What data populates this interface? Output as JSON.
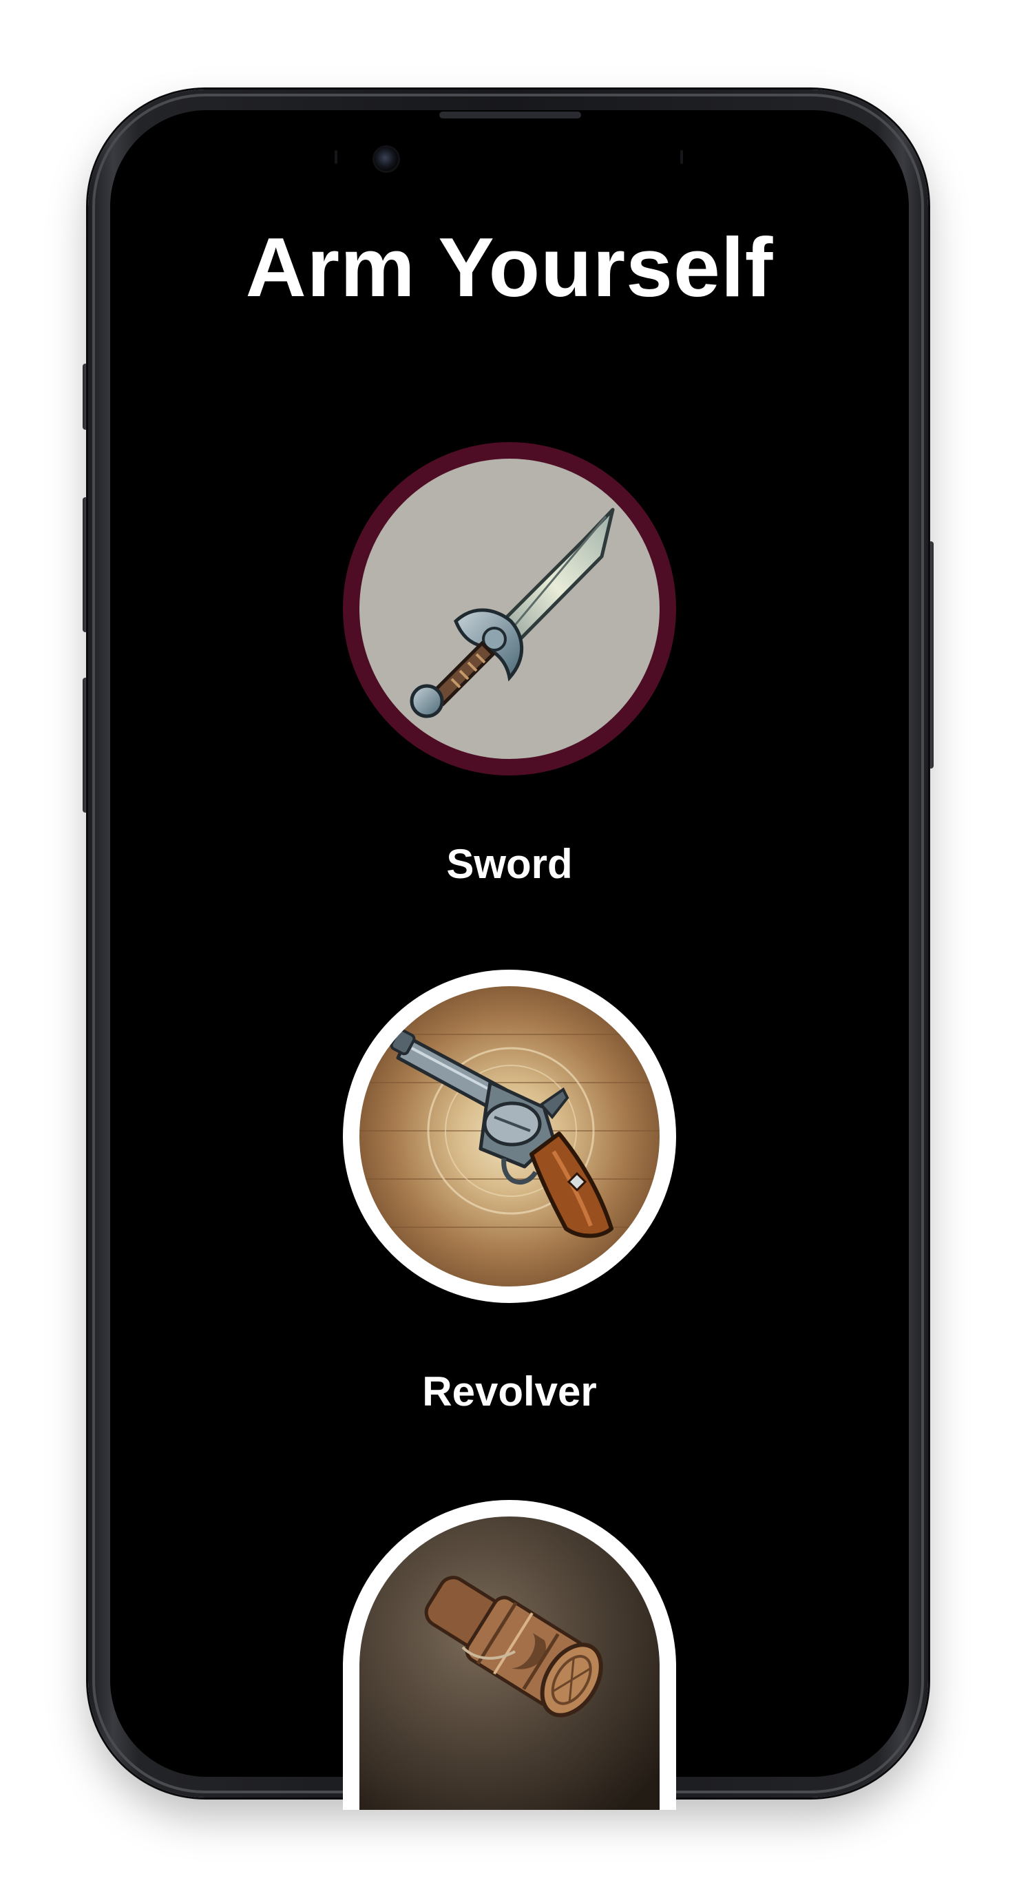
{
  "page": {
    "title": "Arm Yourself"
  },
  "weapons": [
    {
      "label": "Sword",
      "icon": "sword-icon",
      "ring_color": "#4e0d24",
      "selected": true
    },
    {
      "label": "Revolver",
      "icon": "revolver-icon",
      "ring_color": "#ffffff",
      "selected": false
    },
    {
      "label": "",
      "icon": "carved-wooden-item-icon",
      "ring_color": "#ffffff",
      "selected": false
    }
  ],
  "colors": {
    "screen_background": "#000000",
    "title_text": "#ffffff",
    "selected_ring": "#4e0d24",
    "default_ring": "#ffffff"
  }
}
